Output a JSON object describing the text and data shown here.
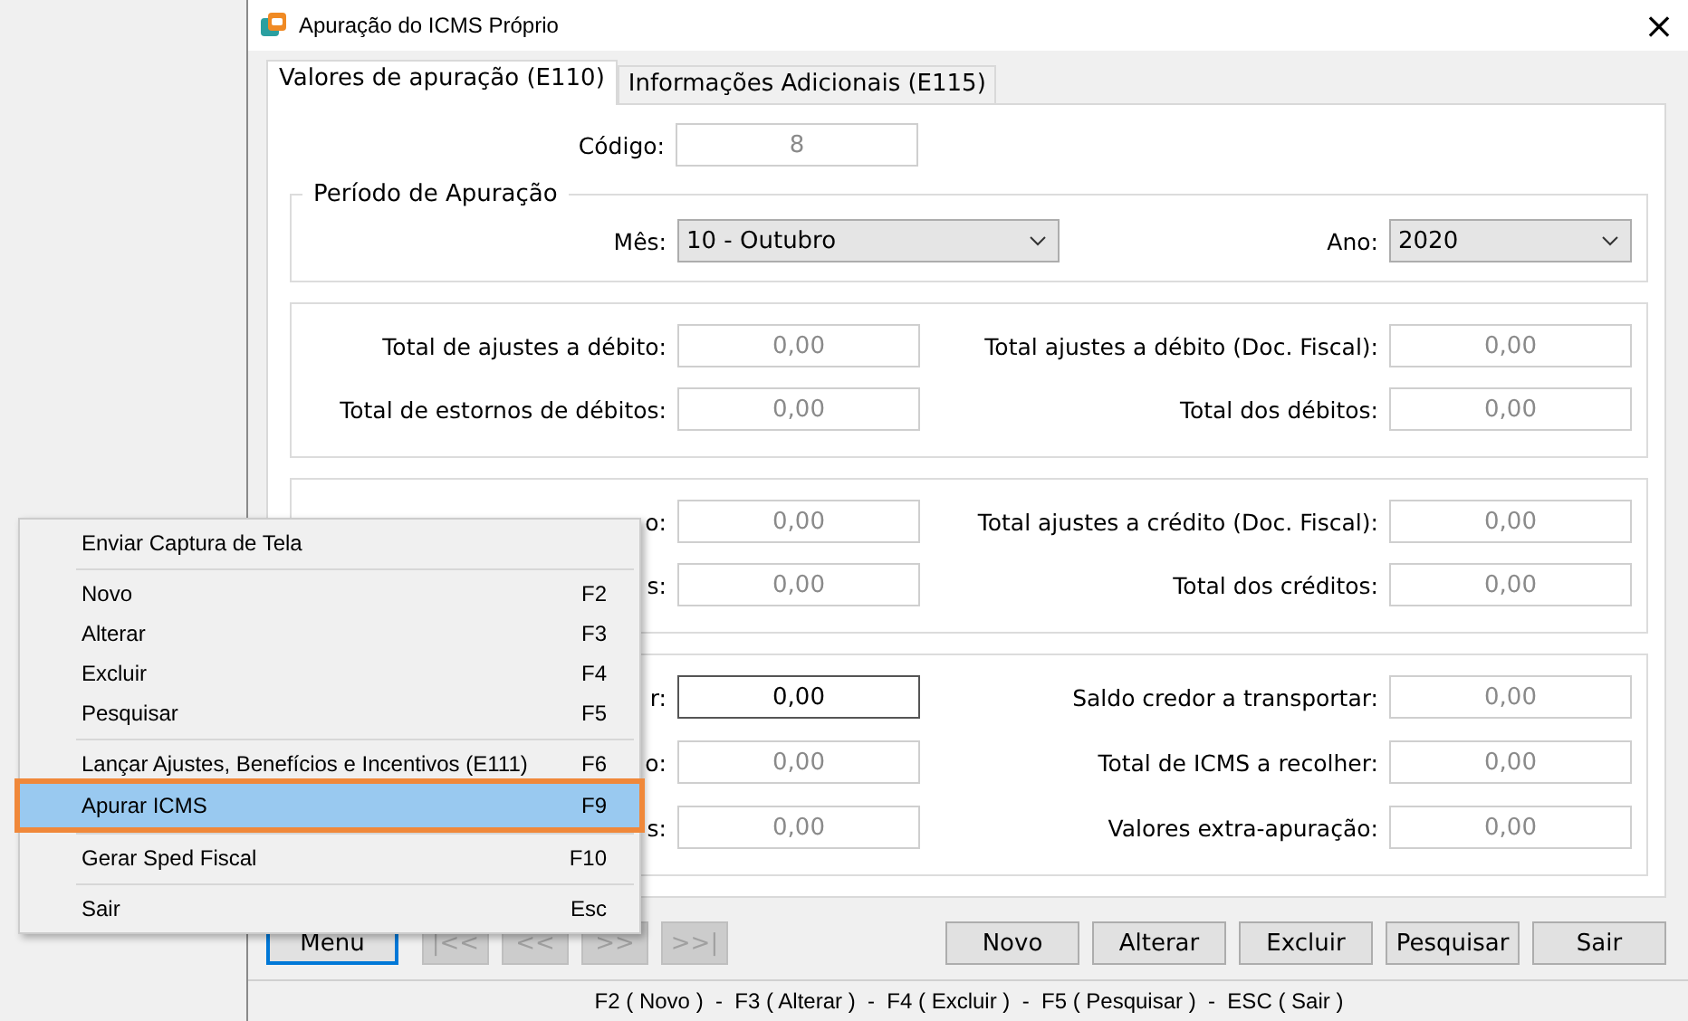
{
  "window": {
    "title": "Apuração do ICMS Próprio",
    "close": "×"
  },
  "tabs": [
    {
      "label": "Valores de apuração (E110)",
      "selected": true
    },
    {
      "label": "Informações Adicionais (E115)",
      "selected": false
    }
  ],
  "codigo": {
    "label": "Código:",
    "value": "8",
    "disabled": true
  },
  "periodo": {
    "title": "Período de Apuração",
    "fields": [
      {
        "label": "Mês:",
        "value": "10 - Outubro"
      },
      {
        "label": "Ano:",
        "value": "2020"
      }
    ]
  },
  "groups": [
    {
      "fields": [
        {
          "label": "Total de ajustes a débito:",
          "value": "0,00",
          "disabled": true
        },
        {
          "label": "Total ajustes a débito (Doc. Fiscal):",
          "value": "0,00",
          "disabled": true
        },
        {
          "label": "Total de estornos de débitos:",
          "value": "0,00",
          "disabled": true
        },
        {
          "label": "Total dos débitos:",
          "value": "0,00",
          "disabled": true
        }
      ]
    },
    {
      "fields": [
        {
          "label": "o:",
          "value": "0,00",
          "disabled": true
        },
        {
          "label": "Total ajustes a crédito (Doc. Fiscal):",
          "value": "0,00",
          "disabled": true
        },
        {
          "label": "s:",
          "value": "0,00",
          "disabled": true
        },
        {
          "label": "Total dos créditos:",
          "value": "0,00",
          "disabled": true
        }
      ]
    },
    {
      "fields": [
        {
          "label": "r:",
          "value": "0,00",
          "disabled": false
        },
        {
          "label": "Saldo credor a transportar:",
          "value": "0,00",
          "disabled": true
        },
        {
          "label": "o:",
          "value": "0,00",
          "disabled": true
        },
        {
          "label": "Total de ICMS a recolher:",
          "value": "0,00",
          "disabled": true
        },
        {
          "label": "s:",
          "value": "0,00",
          "disabled": true
        },
        {
          "label": "Valores extra-apuração:",
          "value": "0,00",
          "disabled": true
        }
      ]
    }
  ],
  "nav_buttons": [
    {
      "label": "Menu",
      "disabled": false
    },
    {
      "label": "|<<",
      "disabled": true
    },
    {
      "label": "<<",
      "disabled": true
    },
    {
      "label": ">>",
      "disabled": true
    },
    {
      "label": ">>|",
      "disabled": true
    }
  ],
  "action_buttons": [
    {
      "label": "Novo"
    },
    {
      "label": "Alterar"
    },
    {
      "label": "Excluir"
    },
    {
      "label": "Pesquisar"
    },
    {
      "label": "Sair"
    }
  ],
  "status_bar": "F2 ( Novo )  -  F3 ( Alterar )  -  F4 ( Excluir )  -  F5 ( Pesquisar )  -  ESC ( Sair )",
  "context_menu": [
    {
      "kind": "item",
      "label": "Enviar Captura de Tela",
      "selected": false
    },
    {
      "kind": "separator"
    },
    {
      "kind": "item",
      "label": "Novo",
      "shortcut": "F2",
      "selected": false
    },
    {
      "kind": "item",
      "label": "Alterar",
      "shortcut": "F3",
      "selected": false
    },
    {
      "kind": "item",
      "label": "Excluir",
      "shortcut": "F4",
      "selected": false
    },
    {
      "kind": "item",
      "label": "Pesquisar",
      "shortcut": "F5",
      "selected": false
    },
    {
      "kind": "separator"
    },
    {
      "kind": "item",
      "label": "Lançar Ajustes, Benefícios e Incentivos (E111)",
      "shortcut": "F6",
      "selected": false
    },
    {
      "kind": "item",
      "label": "Apurar ICMS",
      "shortcut": "F9",
      "selected": true
    },
    {
      "kind": "separator"
    },
    {
      "kind": "item",
      "label": "Gerar Sped Fiscal",
      "shortcut": "F10",
      "selected": false
    },
    {
      "kind": "separator"
    },
    {
      "kind": "item",
      "label": "Sair",
      "shortcut": "Esc",
      "selected": false
    }
  ]
}
